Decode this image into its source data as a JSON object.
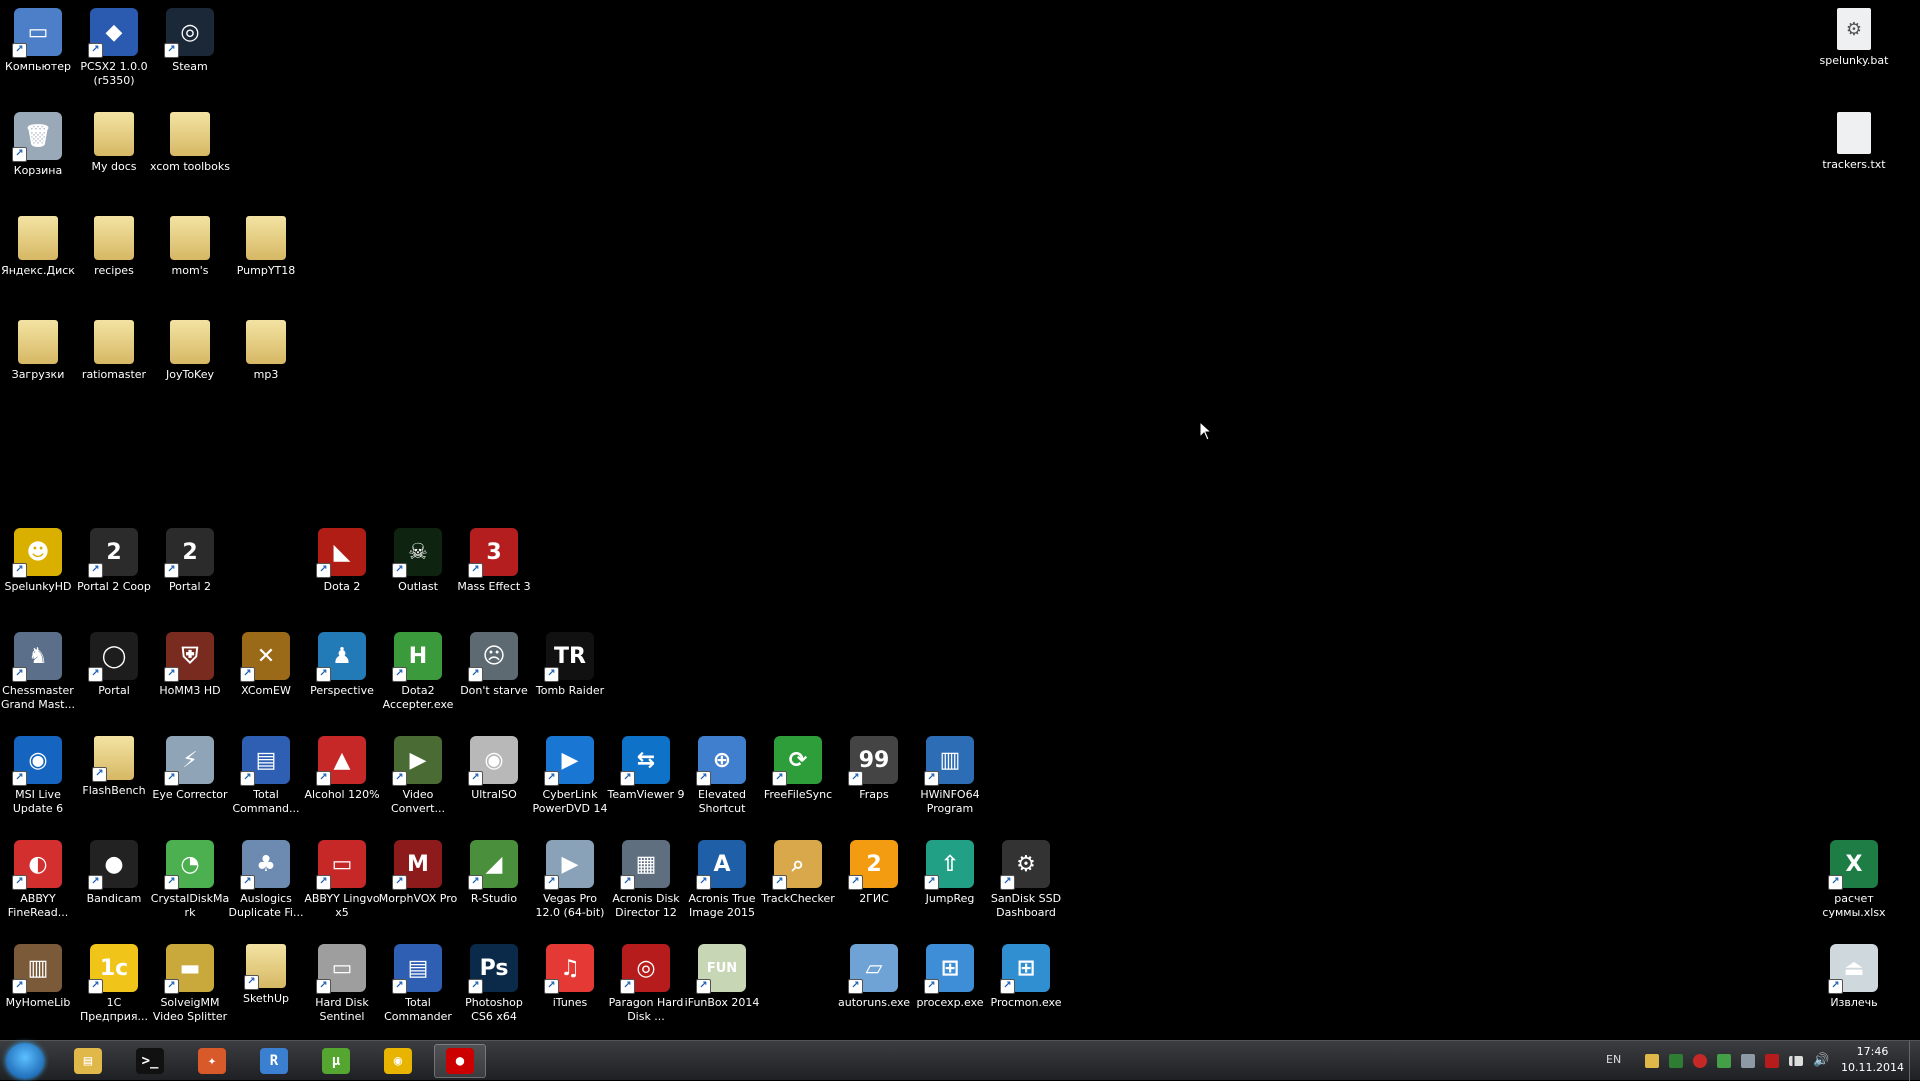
{
  "desktop": {
    "icons": [
      {
        "label": "Компьютер",
        "kind": "app",
        "bg": "#4c7fc7",
        "glyph": "▭",
        "name": "computer-icon"
      },
      {
        "label": "PCSX2 1.0.0 (r5350)",
        "kind": "app",
        "bg": "#2a5bb0",
        "glyph": "◆",
        "name": "pcsx2-icon"
      },
      {
        "label": "Steam",
        "kind": "app",
        "bg": "#1b2838",
        "glyph": "◎",
        "name": "steam-icon"
      },
      {
        "label": "spelunky.bat",
        "kind": "file",
        "bg": "#e9ecef",
        "glyph": "⚙",
        "name": "bat-file-icon"
      },
      {
        "label": "Корзина",
        "kind": "app",
        "bg": "#9aa9b8",
        "glyph": "🗑",
        "name": "recycle-bin-icon"
      },
      {
        "label": "My docs",
        "kind": "folder",
        "name": "folder-icon"
      },
      {
        "label": "xcom toolboks",
        "kind": "folder",
        "name": "folder-icon"
      },
      {
        "label": "trackers.txt",
        "kind": "file",
        "bg": "#f5f5f5",
        "glyph": "",
        "name": "text-file-icon"
      },
      {
        "label": "Яндекс.Диск",
        "kind": "folder",
        "name": "yandex-disk-folder-icon"
      },
      {
        "label": "recipes",
        "kind": "folder",
        "name": "folder-icon"
      },
      {
        "label": "mom's",
        "kind": "folder",
        "name": "folder-icon"
      },
      {
        "label": "PumpYT18",
        "kind": "folder",
        "name": "folder-icon"
      },
      {
        "label": "Загрузки",
        "kind": "folder",
        "name": "downloads-folder-icon"
      },
      {
        "label": "ratiomaster",
        "kind": "folder",
        "name": "folder-icon"
      },
      {
        "label": "JoyToKey",
        "kind": "folder",
        "name": "folder-icon"
      },
      {
        "label": "mp3",
        "kind": "folder",
        "name": "folder-icon"
      },
      {
        "label": "SpelunkyHD",
        "kind": "app",
        "bg": "#d9b000",
        "glyph": "☻",
        "name": "spelunky-icon"
      },
      {
        "label": "Portal 2 Coop",
        "kind": "app",
        "bg": "#2b2b2b",
        "glyph": "2",
        "name": "portal2-coop-icon"
      },
      {
        "label": "Portal 2",
        "kind": "app",
        "bg": "#2b2b2b",
        "glyph": "2",
        "name": "portal2-icon"
      },
      {
        "label": "Dota 2",
        "kind": "app",
        "bg": "#b01d14",
        "glyph": "◣",
        "name": "dota2-icon"
      },
      {
        "label": "Outlast",
        "kind": "app",
        "bg": "#0f2410",
        "glyph": "☠",
        "name": "outlast-icon"
      },
      {
        "label": "Mass Effect 3",
        "kind": "app",
        "bg": "#b51e1e",
        "glyph": "3",
        "name": "mass-effect-3-icon"
      },
      {
        "label": "Chessmaster Grand Mast...",
        "kind": "app",
        "bg": "#5b6e8a",
        "glyph": "♞",
        "name": "chessmaster-icon"
      },
      {
        "label": "Portal",
        "kind": "app",
        "bg": "#1d1d1d",
        "glyph": "◯",
        "name": "portal-icon"
      },
      {
        "label": "HoMM3 HD",
        "kind": "app",
        "bg": "#7a2b20",
        "glyph": "⛨",
        "name": "homm3-icon"
      },
      {
        "label": "XComEW",
        "kind": "app",
        "bg": "#9a6a18",
        "glyph": "✕",
        "name": "xcom-icon"
      },
      {
        "label": "Perspective",
        "kind": "app",
        "bg": "#227ab6",
        "glyph": "♟",
        "name": "perspective-icon"
      },
      {
        "label": "Dota2 Accepter.exe",
        "kind": "app",
        "bg": "#3b9a3b",
        "glyph": "H",
        "name": "dota2-accepter-icon"
      },
      {
        "label": "Don't starve",
        "kind": "app",
        "bg": "#5d6a72",
        "glyph": "☹",
        "name": "dont-starve-icon"
      },
      {
        "label": "Tomb Raider",
        "kind": "app",
        "bg": "#111",
        "glyph": "TR",
        "name": "tomb-raider-icon"
      },
      {
        "label": "MSI Live Update 6",
        "kind": "app",
        "bg": "#1565c0",
        "glyph": "◉",
        "name": "msi-live-update-icon"
      },
      {
        "label": "FlashBench",
        "kind": "folder",
        "name": "folder-icon"
      },
      {
        "label": "Eye Corrector",
        "kind": "app",
        "bg": "#90a4b8",
        "glyph": "⚡",
        "name": "eye-corrector-icon"
      },
      {
        "label": "Total Command...",
        "kind": "app",
        "bg": "#2f5fb3",
        "glyph": "▤",
        "name": "total-commander-icon"
      },
      {
        "label": "Alcohol 120%",
        "kind": "app",
        "bg": "#c62828",
        "glyph": "▲",
        "name": "alcohol-120-icon"
      },
      {
        "label": "Video Convert...",
        "kind": "app",
        "bg": "#4a6b33",
        "glyph": "▶",
        "name": "video-converter-icon"
      },
      {
        "label": "UltraISO",
        "kind": "app",
        "bg": "#b8b8b8",
        "glyph": "◉",
        "name": "ultraiso-icon"
      },
      {
        "label": "CyberLink PowerDVD 14",
        "kind": "app",
        "bg": "#1976d2",
        "glyph": "▶",
        "name": "powerdvd-icon"
      },
      {
        "label": "TeamViewer 9",
        "kind": "app",
        "bg": "#0e72c9",
        "glyph": "⇆",
        "name": "teamviewer-icon"
      },
      {
        "label": "Elevated Shortcut",
        "kind": "app",
        "bg": "#3f7fce",
        "glyph": "⊕",
        "name": "elevated-shortcut-icon"
      },
      {
        "label": "FreeFileSync",
        "kind": "app",
        "bg": "#2e9e3a",
        "glyph": "⟳",
        "name": "freefilesync-icon"
      },
      {
        "label": "Fraps",
        "kind": "app",
        "bg": "#444",
        "glyph": "99",
        "name": "fraps-icon"
      },
      {
        "label": "HWiNFO64 Program",
        "kind": "app",
        "bg": "#2d6db5",
        "glyph": "▥",
        "name": "hwinfo-icon"
      },
      {
        "label": "ABBYY FineRead...",
        "kind": "app",
        "bg": "#d32f2f",
        "glyph": "◐",
        "name": "abbyy-finereader-icon"
      },
      {
        "label": "Bandicam",
        "kind": "app",
        "bg": "#222",
        "glyph": "●",
        "name": "bandicam-icon"
      },
      {
        "label": "CrystalDiskMark",
        "kind": "app",
        "bg": "#4caf50",
        "glyph": "◔",
        "name": "crystaldiskmark-icon"
      },
      {
        "label": "Auslogics Duplicate Fi...",
        "kind": "app",
        "bg": "#6d8bb0",
        "glyph": "♣",
        "name": "auslogics-icon"
      },
      {
        "label": "ABBYY Lingvo x5",
        "kind": "app",
        "bg": "#c62828",
        "glyph": "▭",
        "name": "abbyy-lingvo-icon"
      },
      {
        "label": "MorphVOX Pro",
        "kind": "app",
        "bg": "#8e1b1b",
        "glyph": "M",
        "name": "morphvox-icon"
      },
      {
        "label": "R-Studio",
        "kind": "app",
        "bg": "#4a8f3c",
        "glyph": "◢",
        "name": "r-studio-icon"
      },
      {
        "label": "Vegas Pro 12.0 (64-bit)",
        "kind": "app",
        "bg": "#8aa2b8",
        "glyph": "▶",
        "name": "vegas-pro-icon"
      },
      {
        "label": "Acronis Disk Director 12",
        "kind": "app",
        "bg": "#5f6f80",
        "glyph": "▦",
        "name": "acronis-disk-director-icon"
      },
      {
        "label": "Acronis True Image 2015",
        "kind": "app",
        "bg": "#1f5fa8",
        "glyph": "A",
        "name": "acronis-true-image-icon"
      },
      {
        "label": "TrackChecker",
        "kind": "app",
        "bg": "#d8a84a",
        "glyph": "⌕",
        "name": "trackchecker-icon"
      },
      {
        "label": "2ГИС",
        "kind": "app",
        "bg": "#f39c12",
        "glyph": "2",
        "name": "2gis-icon"
      },
      {
        "label": "JumpReg",
        "kind": "app",
        "bg": "#22a086",
        "glyph": "⇧",
        "name": "jumpreg-icon"
      },
      {
        "label": "SanDisk SSD Dashboard",
        "kind": "app",
        "bg": "#333",
        "glyph": "⚙",
        "name": "sandisk-dashboard-icon"
      },
      {
        "label": "расчет суммы.xlsx",
        "kind": "app",
        "bg": "#1e7d45",
        "glyph": "X",
        "name": "excel-file-icon"
      },
      {
        "label": "MyHomeLib",
        "kind": "app",
        "bg": "#7b5a3a",
        "glyph": "▥",
        "name": "myhomelib-icon"
      },
      {
        "label": "1С Предприя...",
        "kind": "app",
        "bg": "#f0c419",
        "glyph": "1c",
        "name": "1c-icon"
      },
      {
        "label": "SolveigMM Video Splitter",
        "kind": "app",
        "bg": "#c9a83c",
        "glyph": "▬",
        "name": "solveigmm-icon"
      },
      {
        "label": "SkethUp",
        "kind": "folder",
        "name": "folder-icon"
      },
      {
        "label": "Hard Disk Sentinel",
        "kind": "app",
        "bg": "#9e9e9e",
        "glyph": "▭",
        "name": "hard-disk-sentinel-icon"
      },
      {
        "label": "Total Commander",
        "kind": "app",
        "bg": "#2f5fb3",
        "glyph": "▤",
        "name": "total-commander-icon"
      },
      {
        "label": "Photoshop CS6 x64",
        "kind": "app",
        "bg": "#0b2a4a",
        "glyph": "Ps",
        "name": "photoshop-icon"
      },
      {
        "label": "iTunes",
        "kind": "app",
        "bg": "#e53935",
        "glyph": "♫",
        "name": "itunes-icon"
      },
      {
        "label": "Paragon Hard Disk ...",
        "kind": "app",
        "bg": "#b71c1c",
        "glyph": "◎",
        "name": "paragon-icon"
      },
      {
        "label": "iFunBox 2014",
        "kind": "app",
        "bg": "#c7d6b5",
        "glyph": "FUN",
        "name": "ifunbox-icon"
      },
      {
        "label": "autoruns.exe",
        "kind": "app",
        "bg": "#6fa3d6",
        "glyph": "▱",
        "name": "autoruns-icon"
      },
      {
        "label": "procexp.exe",
        "kind": "app",
        "bg": "#3d8ed6",
        "glyph": "⊞",
        "name": "procexp-icon"
      },
      {
        "label": "Procmon.exe",
        "kind": "app",
        "bg": "#2f8fd0",
        "glyph": "⊞",
        "name": "procmon-icon"
      },
      {
        "label": "Извлечь",
        "kind": "app",
        "bg": "#cfd8dc",
        "glyph": "⏏",
        "name": "eject-icon"
      }
    ]
  },
  "taskbar": {
    "language": "EN",
    "clock_time": "17:46",
    "clock_date": "10.11.2014",
    "buttons": [
      {
        "name": "explorer-taskbar-button",
        "glyph": "▤",
        "bg": "#e0b84a"
      },
      {
        "name": "terminal-taskbar-button",
        "glyph": ">_",
        "bg": "#111"
      },
      {
        "name": "app-taskbar-button",
        "glyph": "✦",
        "bg": "#d85a2a"
      },
      {
        "name": "app-r-taskbar-button",
        "glyph": "R",
        "bg": "#3a7fd0"
      },
      {
        "name": "utorrent-taskbar-button",
        "glyph": "µ",
        "bg": "#55a630"
      },
      {
        "name": "chrome-taskbar-button",
        "glyph": "◉",
        "bg": "#e8b400"
      },
      {
        "name": "bandicam-taskbar-button",
        "glyph": "●",
        "bg": "#c00"
      }
    ]
  }
}
